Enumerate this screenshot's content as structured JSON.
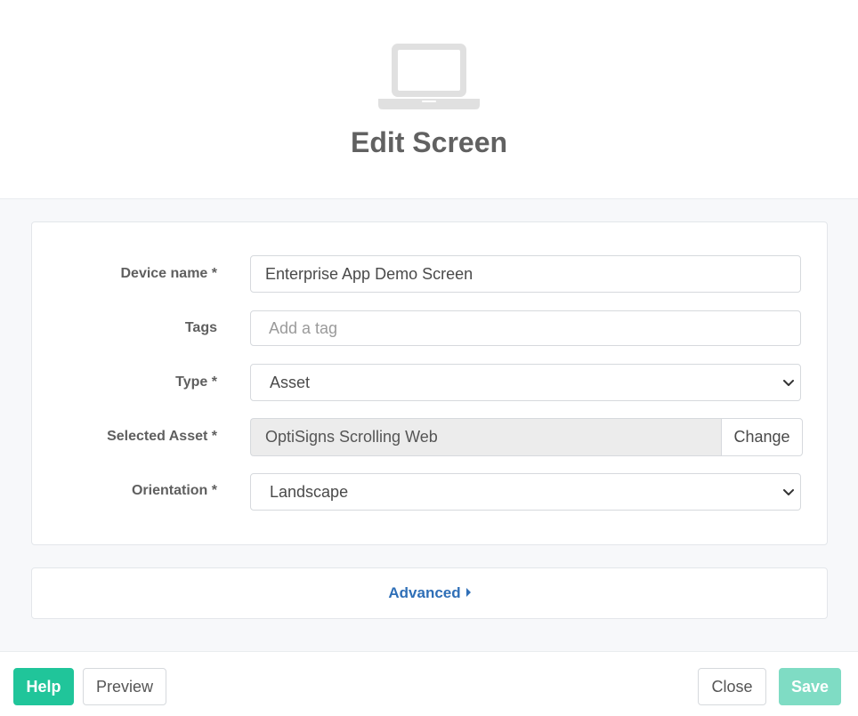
{
  "header": {
    "icon": "laptop-icon",
    "title": "Edit Screen"
  },
  "form": {
    "device_name": {
      "label": "Device name *",
      "value": "Enterprise App Demo Screen"
    },
    "tags": {
      "label": "Tags",
      "placeholder": "Add a tag"
    },
    "type": {
      "label": "Type *",
      "value": "Asset"
    },
    "selected_asset": {
      "label": "Selected Asset *",
      "value": "OptiSigns Scrolling Web",
      "change_label": "Change"
    },
    "orientation": {
      "label": "Orientation *",
      "value": "Landscape"
    }
  },
  "advanced": {
    "label": "Advanced"
  },
  "footer": {
    "help_label": "Help",
    "preview_label": "Preview",
    "close_label": "Close",
    "save_label": "Save"
  },
  "colors": {
    "accent": "#20c59a",
    "accent_disabled": "#7fdcc4",
    "link": "#2f6fb7",
    "title": "#616161",
    "background": "#f7f8fa"
  }
}
